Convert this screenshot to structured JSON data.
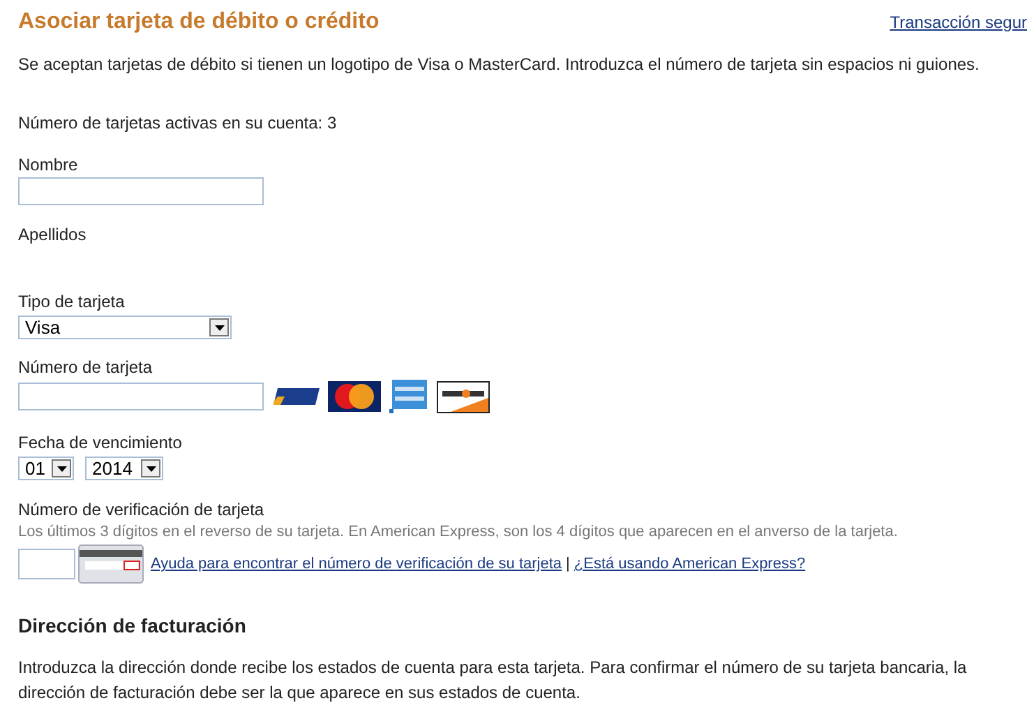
{
  "title": "Asociar tarjeta de débito o crédito",
  "secure_link": "Transacción segur",
  "intro": "Se aceptan tarjetas de débito si tienen un logotipo de Visa o MasterCard. Introduzca el número de tarjeta sin espacios ni guiones.",
  "active_cards": "Número de tarjetas activas en su cuenta: 3",
  "first_name": {
    "label": "Nombre"
  },
  "last_name": {
    "label": "Apellidos"
  },
  "card_type": {
    "label": "Tipo de tarjeta",
    "value": "Visa"
  },
  "card_number": {
    "label": "Número de tarjeta",
    "logos": [
      {
        "kind": "visa"
      },
      {
        "kind": "mastercard"
      },
      {
        "kind": "amex"
      },
      {
        "kind": "discover"
      }
    ]
  },
  "expiry": {
    "label": "Fecha de vencimiento",
    "month": "01",
    "year": "2014"
  },
  "cvv": {
    "label": "Número de verificación de tarjeta",
    "hint": "Los últimos 3 dígitos en el reverso de su tarjeta. En American Express, son los 4 dígitos que aparecen en el anverso de la tarjeta.",
    "help_link": "Ayuda para encontrar el número de verificación de su tarjeta",
    "separator": "|",
    "amex_link": "¿Está usando American Express?"
  },
  "billing": {
    "heading": "Dirección de facturación",
    "text": "Introduzca la dirección donde recibe los estados de cuenta para esta tarjeta. Para confirmar el número de su tarjeta bancaria, la dirección de facturación debe ser la que aparece en sus estados de cuenta."
  }
}
